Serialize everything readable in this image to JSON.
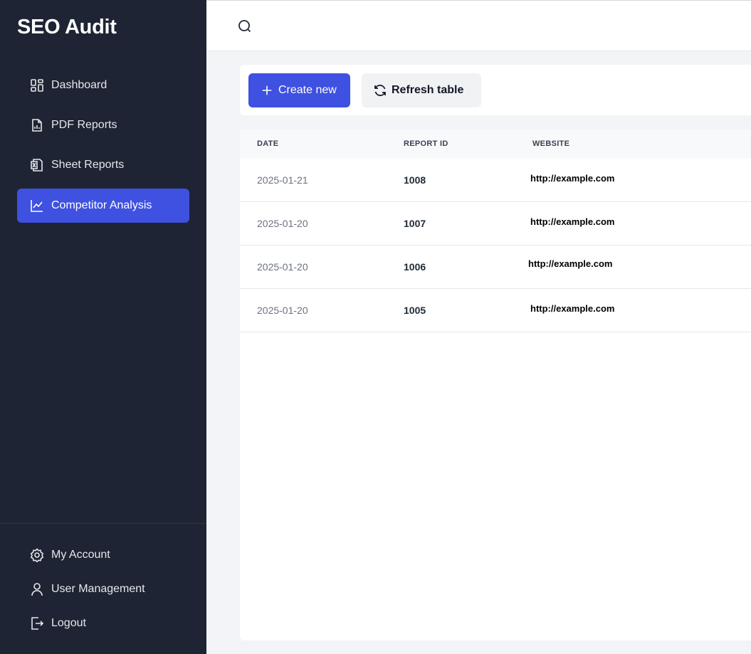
{
  "app": {
    "title": "SEO Audit"
  },
  "sidebar": {
    "items": [
      {
        "label": "Dashboard",
        "icon": "dashboard-icon"
      },
      {
        "label": "PDF Reports",
        "icon": "pdf-report-icon"
      },
      {
        "label": "Sheet Reports",
        "icon": "sheet-report-icon"
      },
      {
        "label": "Competitor Analysis",
        "icon": "chart-line-icon",
        "active": true
      }
    ],
    "footer_items": [
      {
        "label": "My Account",
        "icon": "gear-icon"
      },
      {
        "label": "User Management",
        "icon": "user-icon"
      },
      {
        "label": "Logout",
        "icon": "logout-icon"
      }
    ]
  },
  "toolbar": {
    "create_label": "Create new",
    "refresh_label": "Refresh table"
  },
  "table": {
    "headers": [
      "DATE",
      "REPORT ID",
      "WEBSITE"
    ],
    "rows": [
      {
        "date": "2025-01-21",
        "id": "1008",
        "website": "http://example.com"
      },
      {
        "date": "2025-01-20",
        "id": "1007",
        "website": "http://example.com"
      },
      {
        "date": "2025-01-20",
        "id": "1006",
        "website": "http://example.com"
      },
      {
        "date": "2025-01-20",
        "id": "1005",
        "website": "http://example.com"
      }
    ]
  },
  "colors": {
    "sidebar_bg": "#1e2433",
    "accent": "#3f51e0",
    "page_bg": "#f3f4f8"
  }
}
